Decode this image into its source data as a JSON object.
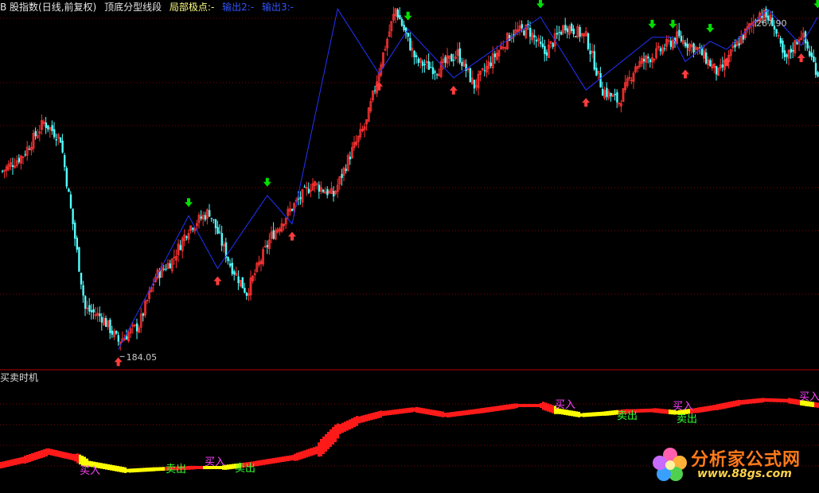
{
  "header": {
    "symbol_name": "B 股指数(日线,前复权)",
    "indicator_name": "顶底分型线段",
    "local_extreme_label": "局部极点:-",
    "output2_label": "输出2:-",
    "output3_label": "输出3:-"
  },
  "sub_panel": {
    "title": "买卖时机"
  },
  "colors": {
    "up": "#ff3232",
    "down": "#54ffff",
    "zigzag": "#2233ff",
    "bottom_arrow": "#ff3c3c",
    "top_arrow": "#00e000",
    "grid": "#8a0000",
    "separator": "#b00000",
    "osc_red": "#ff1a1a",
    "osc_yellow": "#ffff00",
    "buy_text": "#ff44ff",
    "sell_text": "#33ff33"
  },
  "price_labels": {
    "low": "184.05",
    "high": "267.90"
  },
  "signals": [
    {
      "type": "buy",
      "text": "买入"
    },
    {
      "type": "sell",
      "text": "卖出"
    },
    {
      "type": "buy",
      "text": "买入"
    },
    {
      "type": "sell",
      "text": "卖出"
    },
    {
      "type": "buy",
      "text": "买入"
    },
    {
      "type": "sell",
      "text": "卖出"
    },
    {
      "type": "buy",
      "text": "买入"
    },
    {
      "type": "sell",
      "text": "卖出"
    },
    {
      "type": "buy",
      "text": "买入"
    }
  ],
  "watermark": {
    "name": "分析家公式网",
    "url": "www.88gs.com"
  },
  "chart_data": {
    "type": "candlestick",
    "price_series": [
      {
        "day": 0,
        "close": 228
      },
      {
        "day": 10,
        "close": 232
      },
      {
        "day": 20,
        "close": 240
      },
      {
        "day": 28,
        "close": 236
      },
      {
        "day": 34,
        "close": 215
      },
      {
        "day": 40,
        "close": 194
      },
      {
        "day": 48,
        "close": 192
      },
      {
        "day": 56,
        "close": 186
      },
      {
        "day": 66,
        "close": 190
      },
      {
        "day": 74,
        "close": 202
      },
      {
        "day": 82,
        "close": 206
      },
      {
        "day": 90,
        "close": 214
      },
      {
        "day": 100,
        "close": 218
      },
      {
        "day": 110,
        "close": 205
      },
      {
        "day": 118,
        "close": 198
      },
      {
        "day": 130,
        "close": 212
      },
      {
        "day": 140,
        "close": 219
      },
      {
        "day": 150,
        "close": 225
      },
      {
        "day": 160,
        "close": 222
      },
      {
        "day": 168,
        "close": 232
      },
      {
        "day": 176,
        "close": 240
      },
      {
        "day": 183,
        "close": 255
      },
      {
        "day": 190,
        "close": 268
      },
      {
        "day": 200,
        "close": 255
      },
      {
        "day": 210,
        "close": 253
      },
      {
        "day": 220,
        "close": 257
      },
      {
        "day": 228,
        "close": 249
      },
      {
        "day": 236,
        "close": 255
      },
      {
        "day": 246,
        "close": 262
      },
      {
        "day": 254,
        "close": 263
      },
      {
        "day": 262,
        "close": 257
      },
      {
        "day": 272,
        "close": 264
      },
      {
        "day": 282,
        "close": 261
      },
      {
        "day": 290,
        "close": 248
      },
      {
        "day": 298,
        "close": 245
      },
      {
        "day": 306,
        "close": 254
      },
      {
        "day": 316,
        "close": 257
      },
      {
        "day": 326,
        "close": 261
      },
      {
        "day": 336,
        "close": 258
      },
      {
        "day": 346,
        "close": 252
      },
      {
        "day": 356,
        "close": 260
      },
      {
        "day": 366,
        "close": 267
      },
      {
        "day": 372,
        "close": 265
      },
      {
        "day": 378,
        "close": 255
      },
      {
        "day": 386,
        "close": 262
      },
      {
        "day": 394,
        "close": 252
      }
    ],
    "swing_points": [
      {
        "day": 56,
        "price": 184.05,
        "kind": "bottom"
      },
      {
        "day": 90,
        "price": 217,
        "kind": "top"
      },
      {
        "day": 104,
        "price": 204,
        "kind": "bottom"
      },
      {
        "day": 128,
        "price": 222,
        "kind": "top"
      },
      {
        "day": 140,
        "price": 215,
        "kind": "bottom"
      },
      {
        "day": 162,
        "price": 268,
        "kind": "top"
      },
      {
        "day": 182,
        "price": 252,
        "kind": "bottom"
      },
      {
        "day": 196,
        "price": 263,
        "kind": "top"
      },
      {
        "day": 218,
        "price": 251,
        "kind": "bottom"
      },
      {
        "day": 260,
        "price": 266,
        "kind": "top"
      },
      {
        "day": 282,
        "price": 248,
        "kind": "bottom"
      },
      {
        "day": 314,
        "price": 261,
        "kind": "top"
      },
      {
        "day": 324,
        "price": 261,
        "kind": "top"
      },
      {
        "day": 330,
        "price": 255,
        "kind": "bottom"
      },
      {
        "day": 342,
        "price": 260,
        "kind": "top"
      },
      {
        "day": 350,
        "price": 258,
        "kind": "bottom"
      },
      {
        "day": 370,
        "price": 267.9,
        "kind": "top"
      },
      {
        "day": 386,
        "price": 259,
        "kind": "bottom"
      },
      {
        "day": 394,
        "price": 266,
        "kind": "top"
      }
    ]
  }
}
